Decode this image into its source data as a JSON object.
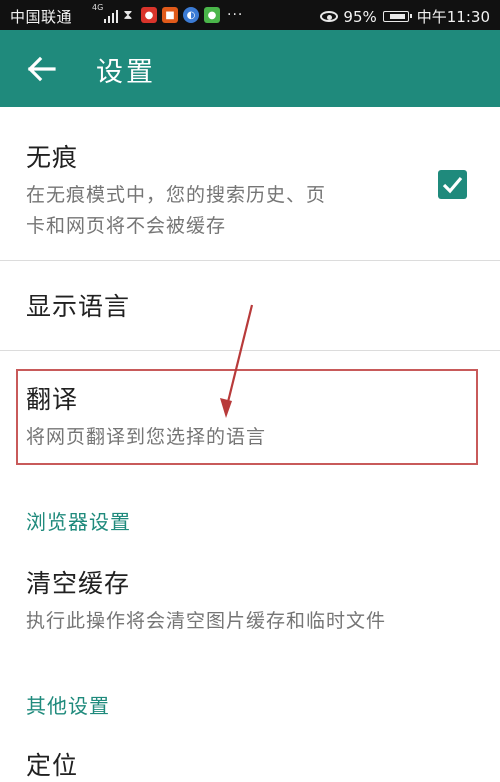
{
  "status_bar": {
    "carrier": "中国联通",
    "network": "4G",
    "battery": "95%",
    "time": "中午11:30",
    "icons": [
      "signal-icon",
      "hourglass-icon",
      "map-pin-icon",
      "news-icon",
      "browser-icon",
      "wechat-icon"
    ]
  },
  "app_bar": {
    "title": "设置",
    "back_icon": "arrow-left-icon"
  },
  "settings": {
    "incognito": {
      "title": "无痕",
      "summary_line1": "在无痕模式中，您的搜索历史、页",
      "summary_line2": "卡和网页将不会被缓存",
      "checked": true
    },
    "display_language": {
      "title": "显示语言"
    },
    "translate": {
      "title": "翻译",
      "summary": "将网页翻译到您选择的语言"
    },
    "browser_section": {
      "header": "浏览器设置"
    },
    "clear_cache": {
      "title": "清空缓存",
      "summary": "执行此操作将会清空图片缓存和临时文件"
    },
    "other_section": {
      "header": "其他设置"
    },
    "location": {
      "title": "定位"
    }
  },
  "colors": {
    "accent": "#1f8a7c",
    "annotation": "#c85a5a"
  }
}
